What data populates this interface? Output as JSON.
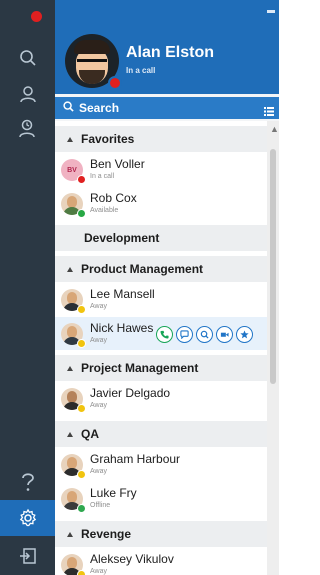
{
  "colors": {
    "rail": "#2b3844",
    "header": "#1f6db8",
    "search_bar": "#2a7bc7",
    "group_bg": "#eceef0",
    "status_busy": "#e02020",
    "status_available": "#27a844",
    "status_away": "#f1c40f",
    "status_offline": "#2fa84f",
    "action_green": "#18a558",
    "action_blue": "#2075c7"
  },
  "rail": {
    "status": "busy",
    "items": [
      {
        "name": "search",
        "icon": "search-icon"
      },
      {
        "name": "contacts",
        "icon": "person-icon"
      },
      {
        "name": "call-history",
        "icon": "person-clock-icon"
      },
      {
        "name": "help",
        "icon": "question-icon"
      },
      {
        "name": "settings",
        "icon": "gear-icon",
        "active": true
      },
      {
        "name": "sign-out",
        "icon": "sign-out-icon"
      }
    ]
  },
  "header": {
    "name": "Alan Elston",
    "status": "In a call"
  },
  "search": {
    "label": "Search"
  },
  "groups": {
    "favorites": "Favorites",
    "development": "Development",
    "product_management_1": "Product Management",
    "product_management_2": "Project Management",
    "qa": "QA",
    "revenge": "Revenge"
  },
  "contacts": {
    "ben": {
      "name": "Ben Voller",
      "status": "In a call",
      "initials": "BV",
      "state": "busy"
    },
    "rob": {
      "name": "Rob Cox",
      "status": "Available",
      "state": "available"
    },
    "lee": {
      "name": "Lee Mansell",
      "status": "Away",
      "state": "away"
    },
    "nick": {
      "name": "Nick Hawes",
      "status": "Away",
      "state": "away"
    },
    "javier": {
      "name": "Javier Delgado",
      "status": "Away",
      "state": "away"
    },
    "graham": {
      "name": "Graham Harbour",
      "status": "Away",
      "state": "away"
    },
    "luke": {
      "name": "Luke Fry",
      "status": "Offline",
      "state": "offline"
    },
    "aleksey": {
      "name": "Aleksey Vikulov",
      "status": "Away",
      "state": "away"
    }
  },
  "hover_actions": [
    {
      "name": "call",
      "icon": "phone-icon",
      "color": "green"
    },
    {
      "name": "chat",
      "icon": "chat-icon",
      "color": "blue"
    },
    {
      "name": "search",
      "icon": "search-icon",
      "color": "blue"
    },
    {
      "name": "video",
      "icon": "video-icon",
      "color": "blue"
    },
    {
      "name": "favorite",
      "icon": "star-icon",
      "color": "blue"
    }
  ]
}
